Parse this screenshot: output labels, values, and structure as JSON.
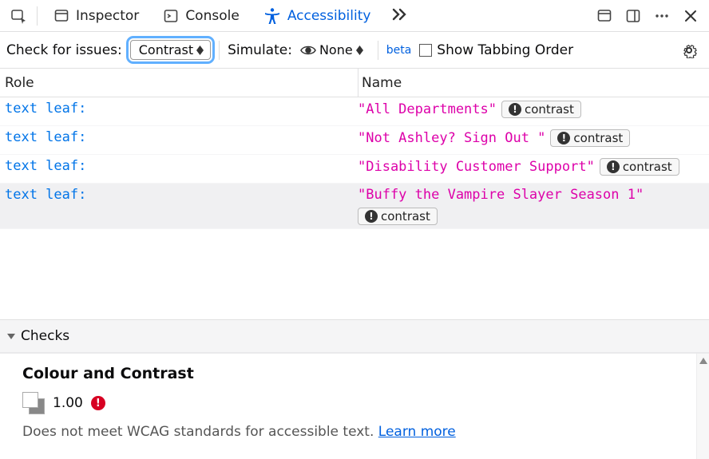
{
  "tabs": {
    "inspector": "Inspector",
    "console": "Console",
    "accessibility": "Accessibility"
  },
  "issuebar": {
    "check_label": "Check for issues:",
    "check_value": "Contrast",
    "simulate_label": "Simulate:",
    "simulate_value": "None",
    "beta": "beta",
    "show_tabbing": "Show Tabbing Order"
  },
  "columns": {
    "role": "Role",
    "name": "Name"
  },
  "rows": [
    {
      "role": "text leaf:",
      "name": "\"All Departments\"",
      "badge": "contrast",
      "selected": false
    },
    {
      "role": "text leaf:",
      "name": "\"Not Ashley? Sign Out \"",
      "badge": "contrast",
      "selected": false
    },
    {
      "role": "text leaf:",
      "name": "\"Disability Customer Support\"",
      "badge": "contrast",
      "selected": false
    },
    {
      "role": "text leaf:",
      "name": "\"Buffy the Vampire Slayer Season 1\"",
      "badge": "contrast",
      "selected": true
    }
  ],
  "checks": {
    "header": "Checks",
    "section": "Colour and Contrast",
    "ratio": "1.00",
    "message_prefix": "Does not meet WCAG standards for accessible text. ",
    "learn_more": "Learn more"
  }
}
